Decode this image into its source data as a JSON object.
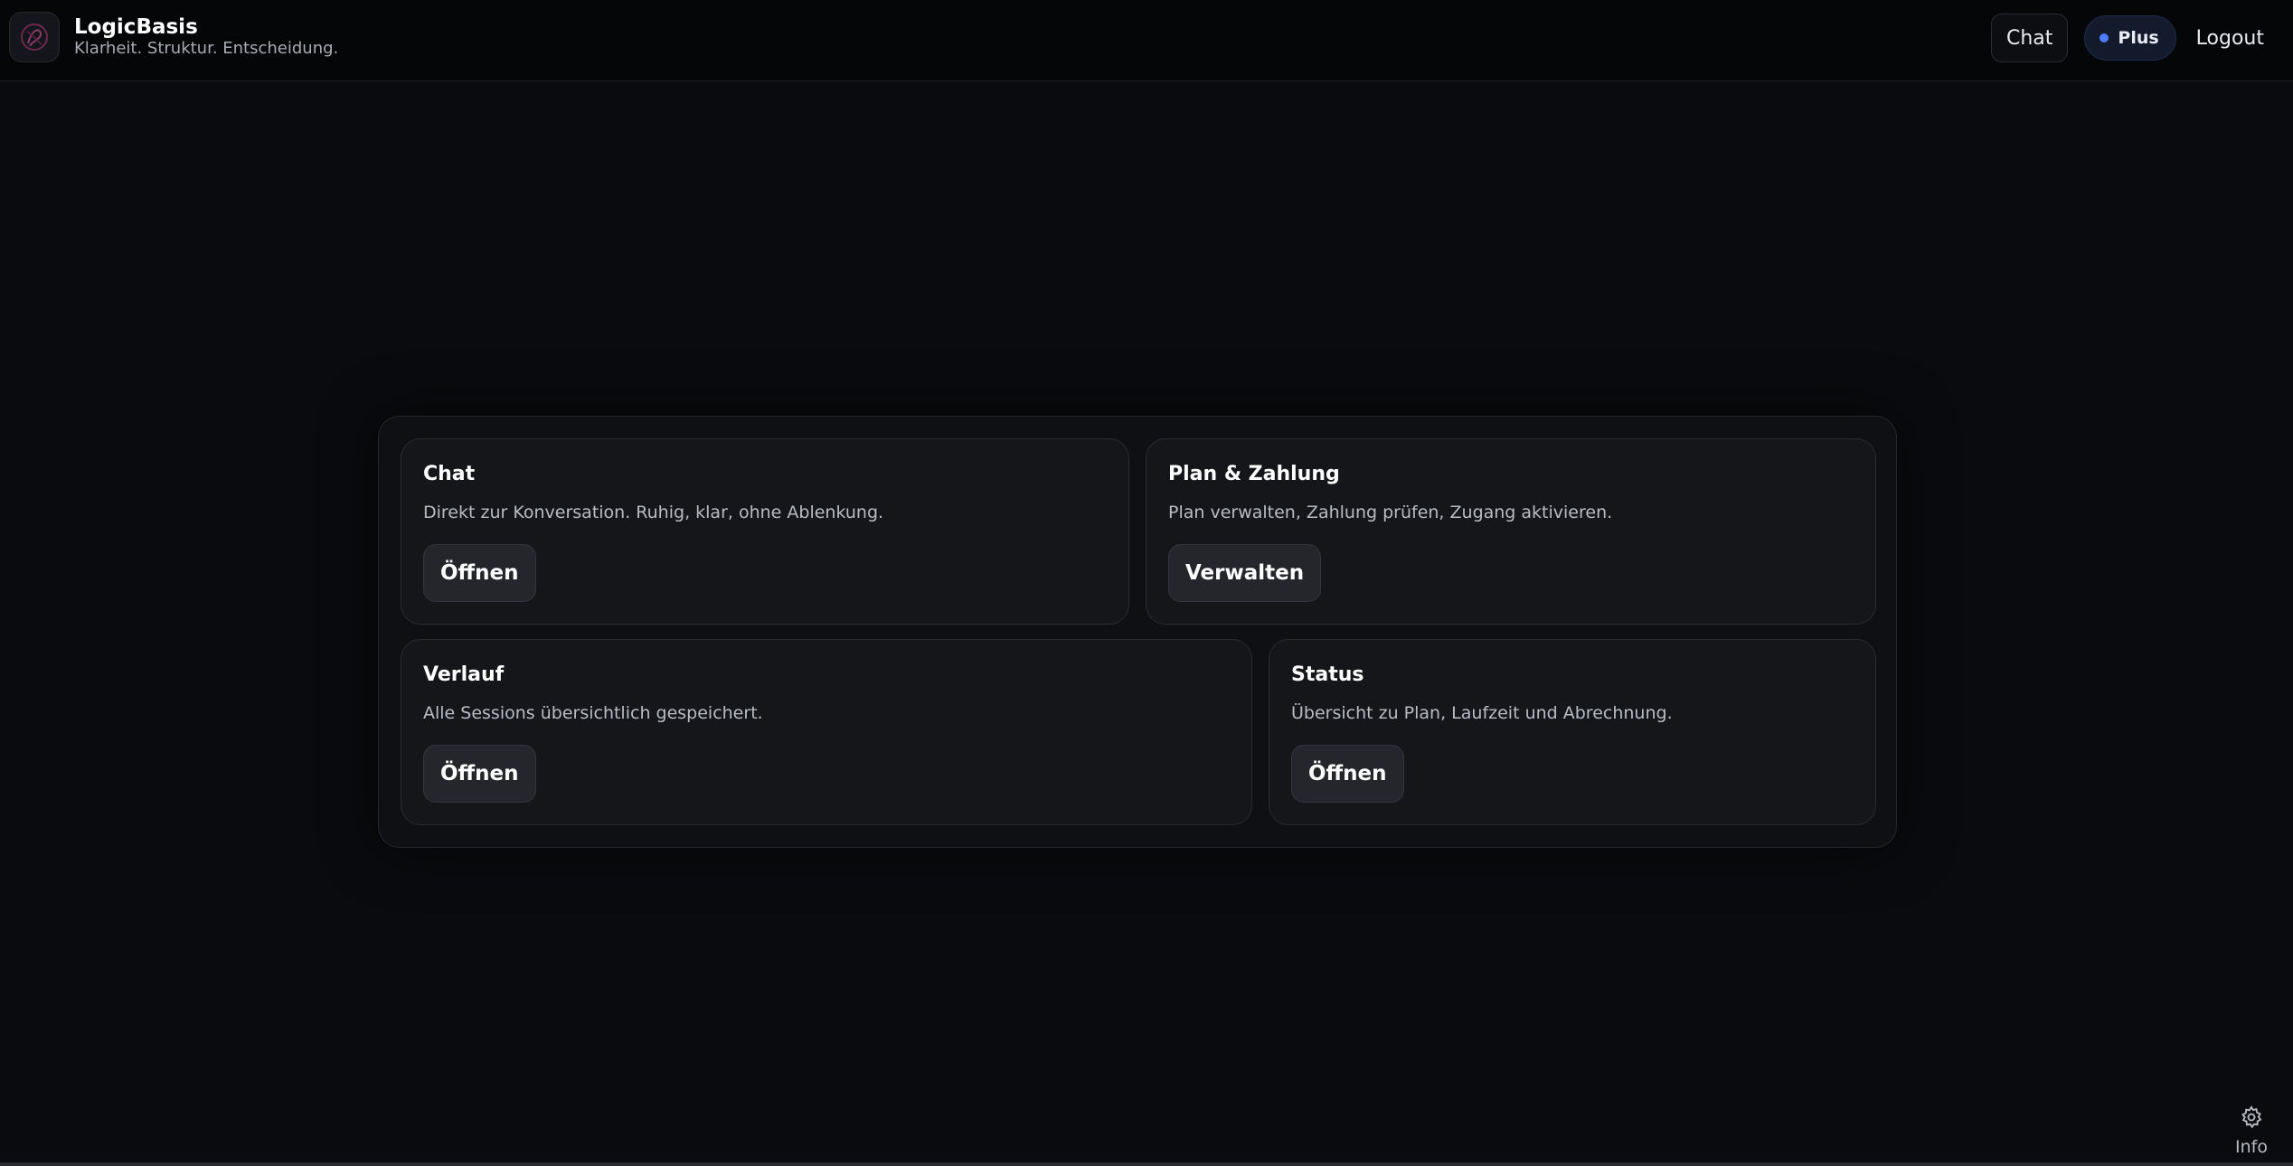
{
  "header": {
    "brand_name": "LogicBasis",
    "tagline": "Klarheit. Struktur. Entscheidung.",
    "nav": {
      "chat_label": "Chat",
      "plan_label": "Plus",
      "logout_label": "Logout"
    }
  },
  "cards": [
    {
      "title": "Chat",
      "description": "Direkt zur Konversation. Ruhig, klar, ohne Ablenkung.",
      "button": "Öffnen"
    },
    {
      "title": "Plan & Zahlung",
      "description": "Plan verwalten, Zahlung prüfen, Zugang aktivieren.",
      "button": "Verwalten"
    },
    {
      "title": "Verlauf",
      "description": "Alle Sessions übersichtlich gespeichert.",
      "button": "Öffnen"
    },
    {
      "title": "Status",
      "description": "Übersicht zu Plan, Laufzeit und Abrechnung.",
      "button": "Öffnen"
    }
  ],
  "footer": {
    "info_label": "Info",
    "icon": "gear-icon"
  },
  "colors": {
    "background": "#0a0b0e",
    "accent": "#4d7cff",
    "card": "#15161a"
  }
}
